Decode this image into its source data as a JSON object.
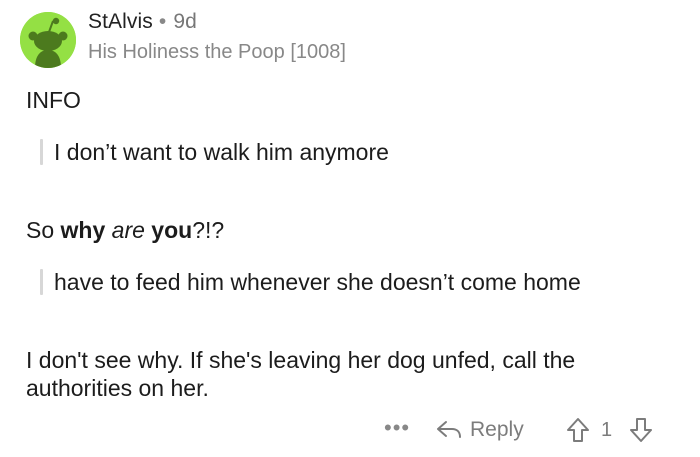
{
  "comment": {
    "author": "StAlvis",
    "separator": "•",
    "age": "9d",
    "flair": "His Holiness the Poop [1008]",
    "paragraphs": {
      "info": "INFO",
      "quote1": "I don’t want to walk him anymore",
      "why_prefix": "So ",
      "why_bold1": "why",
      "why_space1": " ",
      "why_italic": "are",
      "why_space2": " ",
      "why_bold2": "you",
      "why_suffix": "?!?",
      "quote2": "have to feed him whenever she doesn’t come home",
      "final_line1": "I don't see why. If she's leaving her dog unfed, call the",
      "final_line2": "authorities on her."
    }
  },
  "footer": {
    "more_icon": "ellipsis-icon",
    "more_label": "•••",
    "reply_icon": "reply-arrow-icon",
    "reply_label": "Reply",
    "upvote_icon": "upvote-arrow-icon",
    "score": "1",
    "downvote_icon": "downvote-arrow-icon"
  },
  "colors": {
    "avatar_bg": "#94e044",
    "text": "#1c1c1c",
    "muted": "#7c7c7c",
    "quote_bar": "#d7d7d7"
  }
}
